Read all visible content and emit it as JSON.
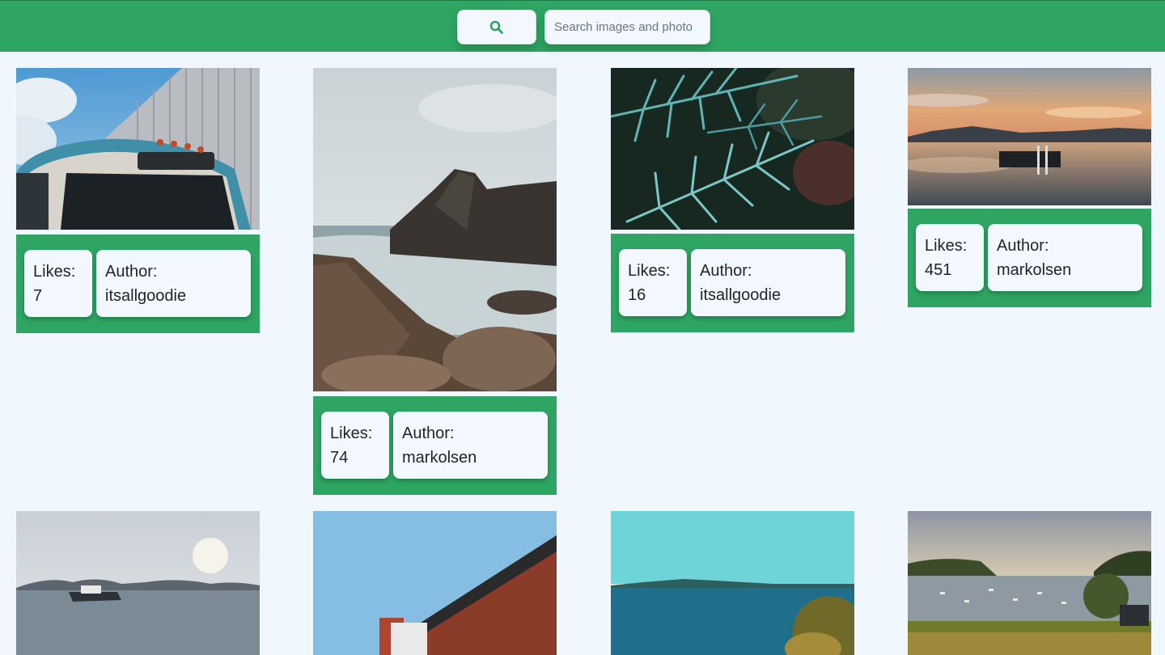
{
  "search": {
    "button_icon": "search-icon",
    "placeholder": "Search images and photo",
    "value": ""
  },
  "labels": {
    "likes": "Likes:",
    "author": "Author:"
  },
  "colors": {
    "accent": "#2ea563",
    "background": "#f0f7ff",
    "pill": "#f3f8ff"
  },
  "cards": [
    {
      "image": "vintage bus",
      "likes": "7",
      "author": "itsallgoodie"
    },
    {
      "image": "rocky shore",
      "likes": "74",
      "author": "markolsen"
    },
    {
      "image": "spruce branch",
      "likes": "16",
      "author": "itsallgoodie"
    },
    {
      "image": "lake sunset dock",
      "likes": "451",
      "author": "markolsen"
    },
    {
      "image": "boat on bay"
    },
    {
      "image": "building sky"
    },
    {
      "image": "blue sea island"
    },
    {
      "image": "harbor boats"
    }
  ]
}
